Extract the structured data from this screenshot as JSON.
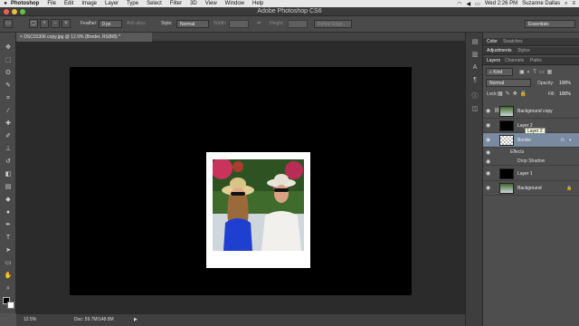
{
  "menubar": {
    "app": "Photoshop",
    "items": [
      "File",
      "Edit",
      "Image",
      "Layer",
      "Type",
      "Select",
      "Filter",
      "3D",
      "View",
      "Window",
      "Help"
    ],
    "clock": "Wed 2:26 PM",
    "user": "Suzanne Dallas"
  },
  "window": {
    "title": "Adobe Photoshop CS6"
  },
  "options": {
    "feather_label": "Feather:",
    "feather_value": "0 px",
    "antialias_label": "Anti-alias",
    "style_label": "Style:",
    "style_value": "Normal",
    "width_label": "Width:",
    "height_label": "Height:",
    "refine_edge": "Refine Edge...",
    "workspace": "Essentials"
  },
  "document": {
    "tab_title": "DSC01306 copy.jpg @ 12.5% (Border, RGB/8) *",
    "zoom": "12.5%",
    "doc_size": "Doc: 59.7M/148.8M"
  },
  "panels": {
    "top_tabs": [
      "Color",
      "Swatches"
    ],
    "mid_tabs": [
      "Adjustments",
      "Styles"
    ],
    "layers_tabs": [
      "Layers",
      "Channels",
      "Paths"
    ],
    "kind_label": "Kind",
    "blend_mode": "Normal",
    "opacity_label": "Opacity:",
    "opacity_value": "100%",
    "lock_label": "Lock:",
    "fill_label": "Fill:",
    "fill_value": "100%",
    "layers": [
      {
        "name": "Background copy",
        "visible": true
      },
      {
        "name": "Layer 2",
        "visible": true
      },
      {
        "name": "Border",
        "visible": true,
        "selected": true,
        "fx": "fx"
      },
      {
        "name": "Layer 1",
        "visible": true
      },
      {
        "name": "Background",
        "visible": true
      }
    ],
    "effects_label": "Effects",
    "drop_shadow_label": "Drop Shadow",
    "tooltip": "Layer 2"
  },
  "colors": {
    "menubar_bg": "#e6e6e6",
    "ui_dark": "#4a4a4a",
    "canvas_bg": "#2b2b2b",
    "selected_layer": "#7a8aa0"
  }
}
